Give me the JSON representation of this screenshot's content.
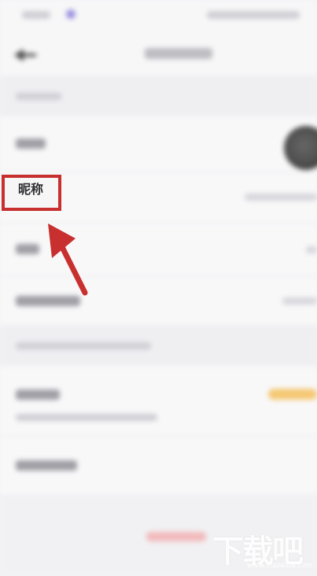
{
  "nickname_label": "昵称",
  "watermark": {
    "title": "下载吧",
    "url": "www.xiazaiba.com"
  },
  "colors": {
    "annotation_red": "#c8302f",
    "badge_yellow": "#f5c873",
    "logout_red": "#f2b9bb"
  },
  "icons": [
    "back-arrow-icon",
    "avatar-icon",
    "pointer-arrow-icon"
  ]
}
